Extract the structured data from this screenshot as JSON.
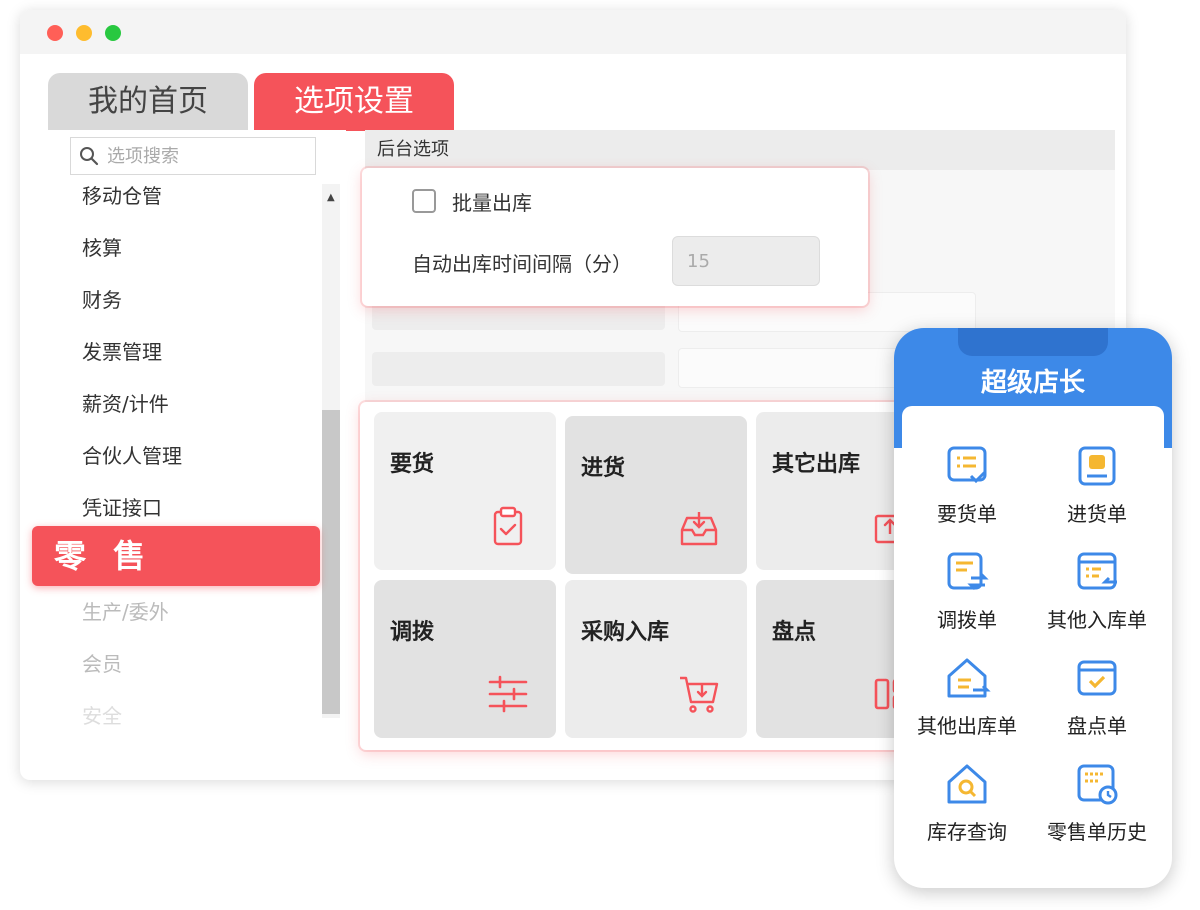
{
  "window": {
    "tabs": [
      {
        "label": "我的首页",
        "active": false
      },
      {
        "label": "选项设置",
        "active": true
      }
    ]
  },
  "sidebar": {
    "search_placeholder": "选项搜索",
    "items": [
      {
        "label": "移动仓管"
      },
      {
        "label": "核算"
      },
      {
        "label": "财务"
      },
      {
        "label": "发票管理"
      },
      {
        "label": "薪资/计件"
      },
      {
        "label": "合伙人管理"
      },
      {
        "label": "凭证接口"
      },
      {
        "label": "零 售",
        "highlighted": true
      },
      {
        "label": "生产/委外"
      },
      {
        "label": "会员"
      },
      {
        "label": "安全"
      }
    ]
  },
  "main": {
    "header": "后台选项",
    "popup": {
      "checkbox_label": "批量出库",
      "checked": false,
      "interval_label": "自动出库时间间隔（分）",
      "interval_value": "15"
    },
    "tiles": [
      {
        "label": "要货",
        "icon": "clipboard-check-icon"
      },
      {
        "label": "进货",
        "icon": "inbox-download-icon"
      },
      {
        "label": "其它出库",
        "icon": "box-upload-icon"
      },
      {
        "label": "调拨",
        "icon": "sliders-icon"
      },
      {
        "label": "采购入库",
        "icon": "cart-download-icon"
      },
      {
        "label": "盘点",
        "icon": "layout-grid-icon"
      }
    ],
    "accent_color": "#f5535a"
  },
  "mobile": {
    "title": "超级店长",
    "brand_color": "#3d89e8",
    "items": [
      {
        "label": "要货单",
        "icon": "order-list-icon"
      },
      {
        "label": "进货单",
        "icon": "receive-goods-icon"
      },
      {
        "label": "调拨单",
        "icon": "transfer-doc-icon"
      },
      {
        "label": "其他入库单",
        "icon": "stock-in-icon"
      },
      {
        "label": "其他出库单",
        "icon": "stock-out-icon"
      },
      {
        "label": "盘点单",
        "icon": "inventory-check-icon"
      },
      {
        "label": "库存查询",
        "icon": "stock-search-icon"
      },
      {
        "label": "零售单历史",
        "icon": "retail-history-icon"
      }
    ]
  }
}
